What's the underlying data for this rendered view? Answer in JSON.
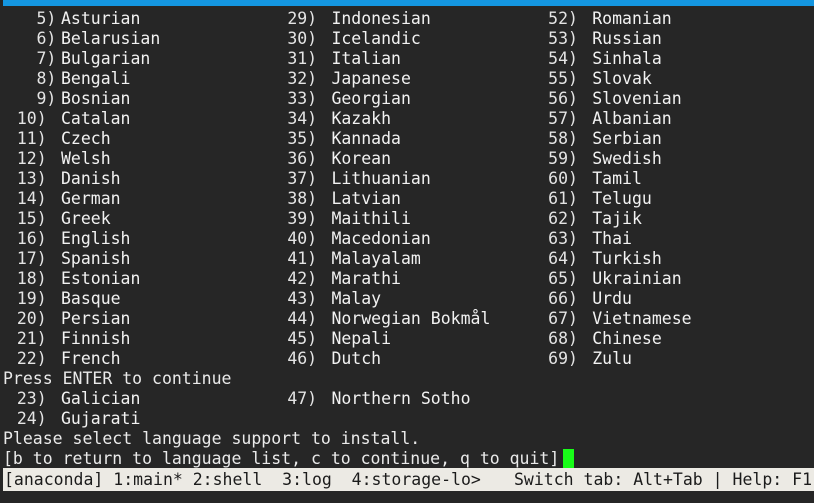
{
  "window": {
    "title_bar_color": "#1496e1",
    "background_color": "#262626",
    "foreground_color": "#e8e8e8",
    "cursor_color": "#18fd18"
  },
  "screen": {
    "columns": [
      {
        "id": "column-1",
        "items": [
          {
            "number": "5)",
            "label": "Asturian"
          },
          {
            "number": "6)",
            "label": "Belarusian"
          },
          {
            "number": "7)",
            "label": "Bulgarian"
          },
          {
            "number": "8)",
            "label": "Bengali"
          },
          {
            "number": "9)",
            "label": "Bosnian"
          },
          {
            "number": "10)",
            "label": "Catalan"
          },
          {
            "number": "11)",
            "label": "Czech"
          },
          {
            "number": "12)",
            "label": "Welsh"
          },
          {
            "number": "13)",
            "label": "Danish"
          },
          {
            "number": "14)",
            "label": "German"
          },
          {
            "number": "15)",
            "label": "Greek"
          },
          {
            "number": "16)",
            "label": "English"
          },
          {
            "number": "17)",
            "label": "Spanish"
          },
          {
            "number": "18)",
            "label": "Estonian"
          },
          {
            "number": "19)",
            "label": "Basque"
          },
          {
            "number": "20)",
            "label": "Persian"
          },
          {
            "number": "21)",
            "label": "Finnish"
          },
          {
            "number": "22)",
            "label": "French"
          }
        ]
      },
      {
        "id": "column-2",
        "items": [
          {
            "number": "29)",
            "label": "Indonesian"
          },
          {
            "number": "30)",
            "label": "Icelandic"
          },
          {
            "number": "31)",
            "label": "Italian"
          },
          {
            "number": "32)",
            "label": "Japanese"
          },
          {
            "number": "33)",
            "label": "Georgian"
          },
          {
            "number": "34)",
            "label": "Kazakh"
          },
          {
            "number": "35)",
            "label": "Kannada"
          },
          {
            "number": "36)",
            "label": "Korean"
          },
          {
            "number": "37)",
            "label": "Lithuanian"
          },
          {
            "number": "38)",
            "label": "Latvian"
          },
          {
            "number": "39)",
            "label": "Maithili"
          },
          {
            "number": "40)",
            "label": "Macedonian"
          },
          {
            "number": "41)",
            "label": "Malayalam"
          },
          {
            "number": "42)",
            "label": "Marathi"
          },
          {
            "number": "43)",
            "label": "Malay"
          },
          {
            "number": "44)",
            "label": "Norwegian Bokmål"
          },
          {
            "number": "45)",
            "label": "Nepali"
          },
          {
            "number": "46)",
            "label": "Dutch"
          }
        ]
      },
      {
        "id": "column-3",
        "items": [
          {
            "number": "52)",
            "label": "Romanian"
          },
          {
            "number": "53)",
            "label": "Russian"
          },
          {
            "number": "54)",
            "label": "Sinhala"
          },
          {
            "number": "55)",
            "label": "Slovak"
          },
          {
            "number": "56)",
            "label": "Slovenian"
          },
          {
            "number": "57)",
            "label": "Albanian"
          },
          {
            "number": "58)",
            "label": "Serbian"
          },
          {
            "number": "59)",
            "label": "Swedish"
          },
          {
            "number": "60)",
            "label": "Tamil"
          },
          {
            "number": "61)",
            "label": "Telugu"
          },
          {
            "number": "62)",
            "label": "Tajik"
          },
          {
            "number": "63)",
            "label": "Thai"
          },
          {
            "number": "64)",
            "label": "Turkish"
          },
          {
            "number": "65)",
            "label": "Ukrainian"
          },
          {
            "number": "66)",
            "label": "Urdu"
          },
          {
            "number": "67)",
            "label": "Vietnamese"
          },
          {
            "number": "68)",
            "label": "Chinese"
          },
          {
            "number": "69)",
            "label": "Zulu"
          }
        ]
      }
    ],
    "press_enter_line": "Press ENTER to continue",
    "overflow_items": [
      {
        "number": "23)",
        "label": "Galician"
      },
      {
        "number": "24)",
        "label": "Gujarati"
      }
    ],
    "overflow_items_col2": [
      {
        "number": "47)",
        "label": "Northern Sotho"
      }
    ],
    "instruction": "Please select language support to install.",
    "prompt": "[b to return to language list, c to continue, q to quit]: "
  },
  "status_bar": {
    "session": "[anaconda]",
    "windows": [
      {
        "index": "1:",
        "name": "main*"
      },
      {
        "index": "2:",
        "name": "shell"
      },
      {
        "index": "3:",
        "name": "log"
      },
      {
        "index": "4:",
        "name": "storage-lo>"
      }
    ],
    "left_text": "[anaconda] 1:main* 2:shell  3:log  4:storage-lo>",
    "right_text": "Switch tab: Alt+Tab | Help: F1"
  }
}
